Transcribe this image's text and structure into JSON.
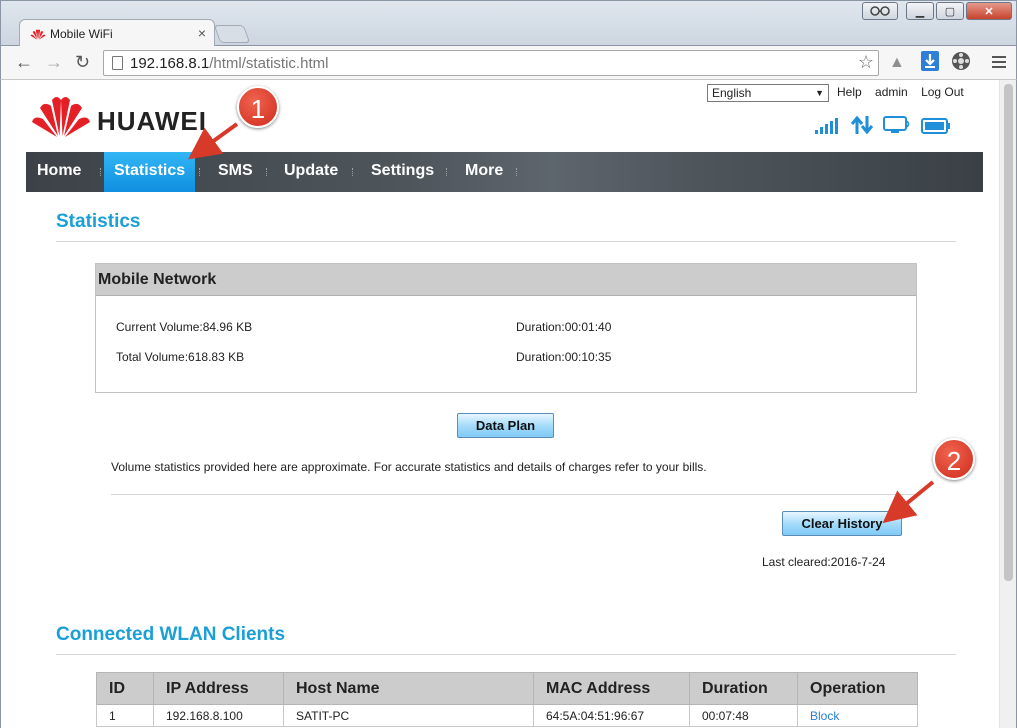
{
  "browser": {
    "tab_title": "Mobile WiFi",
    "tab_close": "×",
    "url_host": "192.168.8.1",
    "url_path": "/html/statistic.html",
    "win_min": "▁",
    "win_max": "▢",
    "win_close": "✕"
  },
  "header": {
    "brand": "HUAWEI",
    "language": "English",
    "links": {
      "help": "Help",
      "user": "admin",
      "logout": "Log Out"
    }
  },
  "nav": {
    "items": [
      {
        "label": "Home"
      },
      {
        "label": "Statistics",
        "active": true
      },
      {
        "label": "SMS"
      },
      {
        "label": "Update"
      },
      {
        "label": "Settings"
      },
      {
        "label": "More"
      }
    ]
  },
  "statistics": {
    "title": "Statistics",
    "panel_title": "Mobile Network",
    "current_volume": "Current Volume:84.96 KB",
    "current_duration": "Duration:00:01:40",
    "total_volume": "Total Volume:618.83 KB",
    "total_duration": "Duration:00:10:35",
    "data_plan_button": "Data Plan",
    "note": "Volume statistics provided here are approximate. For accurate statistics and details of charges refer to your bills.",
    "clear_history_button": "Clear History",
    "last_cleared": "Last cleared:2016-7-24"
  },
  "wlan": {
    "title": "Connected WLAN Clients",
    "columns": [
      "ID",
      "IP Address",
      "Host Name",
      "MAC Address",
      "Duration",
      "Operation"
    ],
    "rows": [
      {
        "id": "1",
        "ip": "192.168.8.100",
        "host": "SATIT-PC",
        "mac": "64:5A:04:51:96:67",
        "duration": "00:07:48",
        "operation": "Block"
      }
    ]
  },
  "annotations": {
    "badge1": "1",
    "badge2": "2"
  },
  "colors": {
    "accent": "#1a9fd7",
    "nav_active": "#1ea6ee",
    "annotation": "#d83a2a"
  },
  "icons": [
    "huawei-logo-icon",
    "back-icon",
    "forward-icon",
    "reload-icon",
    "page-icon",
    "star-icon",
    "signal-icon",
    "data-transfer-icon",
    "monitor-icon",
    "battery-icon",
    "menu-icon"
  ]
}
